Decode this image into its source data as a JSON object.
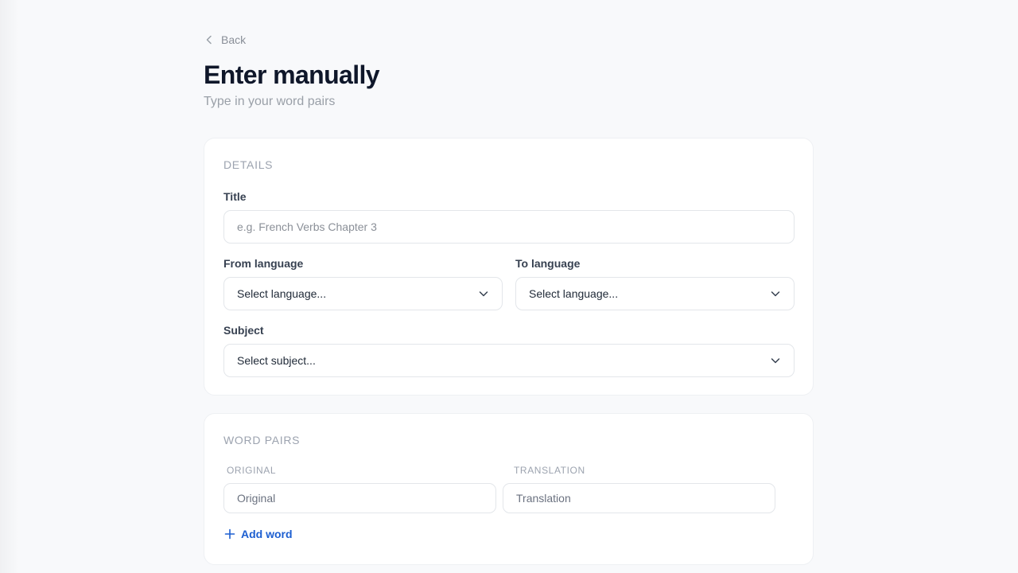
{
  "nav": {
    "back_label": "Back"
  },
  "header": {
    "title": "Enter manually",
    "subtitle": "Type in your word pairs"
  },
  "details": {
    "section_label": "DETAILS",
    "title_field": {
      "label": "Title",
      "placeholder": "e.g. French Verbs Chapter 3",
      "value": ""
    },
    "from_language": {
      "label": "From language",
      "selected": "Select language..."
    },
    "to_language": {
      "label": "To language",
      "selected": "Select language..."
    },
    "subject": {
      "label": "Subject",
      "selected": "Select subject..."
    }
  },
  "word_pairs": {
    "section_label": "WORD PAIRS",
    "columns": {
      "original": "ORIGINAL",
      "translation": "TRANSLATION"
    },
    "rows": [
      {
        "original_placeholder": "Original",
        "translation_placeholder": "Translation"
      }
    ],
    "add_label": "Add word"
  },
  "colors": {
    "accent": "#1d5fd1",
    "background": "#f8f9fb",
    "card": "#ffffff",
    "muted_text": "#9ca3af"
  },
  "icons": {
    "back": "chevron-left-icon",
    "dropdown": "chevron-down-icon",
    "add": "plus-icon"
  }
}
